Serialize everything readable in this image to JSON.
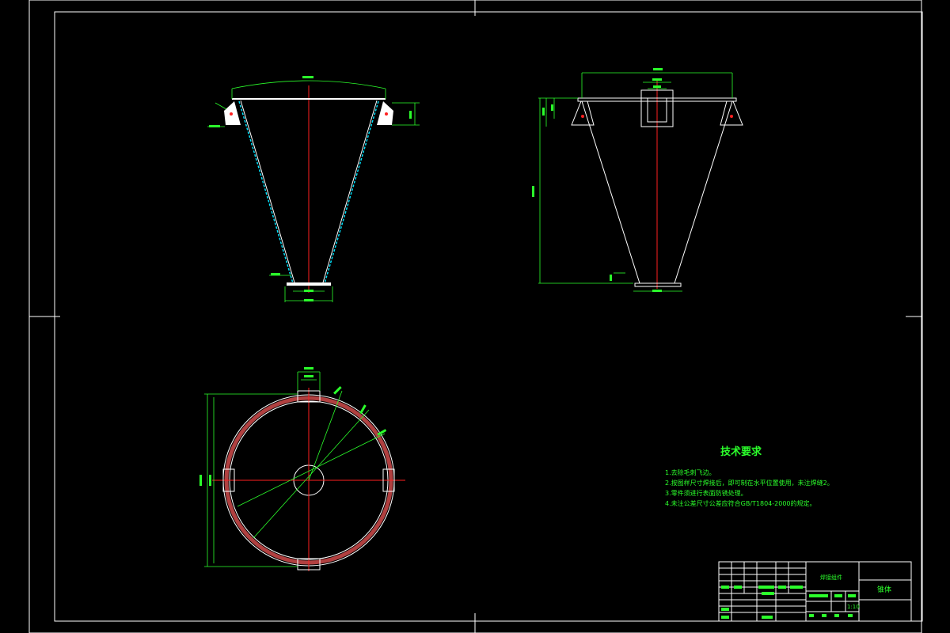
{
  "drawing": {
    "technical_requirements": {
      "title": "技术要求",
      "items": [
        "1.去除毛刺飞边。",
        "2.按图样尺寸焊接后，即可制在水平位置使用，未注焊缝2。",
        "3.零件须进行表面防锈处理。",
        "4.未注公差尺寸公差应符合GB/T1804-2000的规定。"
      ]
    },
    "title_block": {
      "part_name": "锥体",
      "material_label": "焊接组件",
      "scale": "1:10"
    },
    "colors": {
      "background": "#000000",
      "geometry": "#ffffff",
      "dimension": "#2bff2b",
      "centerline": "#ff2020",
      "cyan": "#00e5ff",
      "brown": "#b04040"
    }
  }
}
